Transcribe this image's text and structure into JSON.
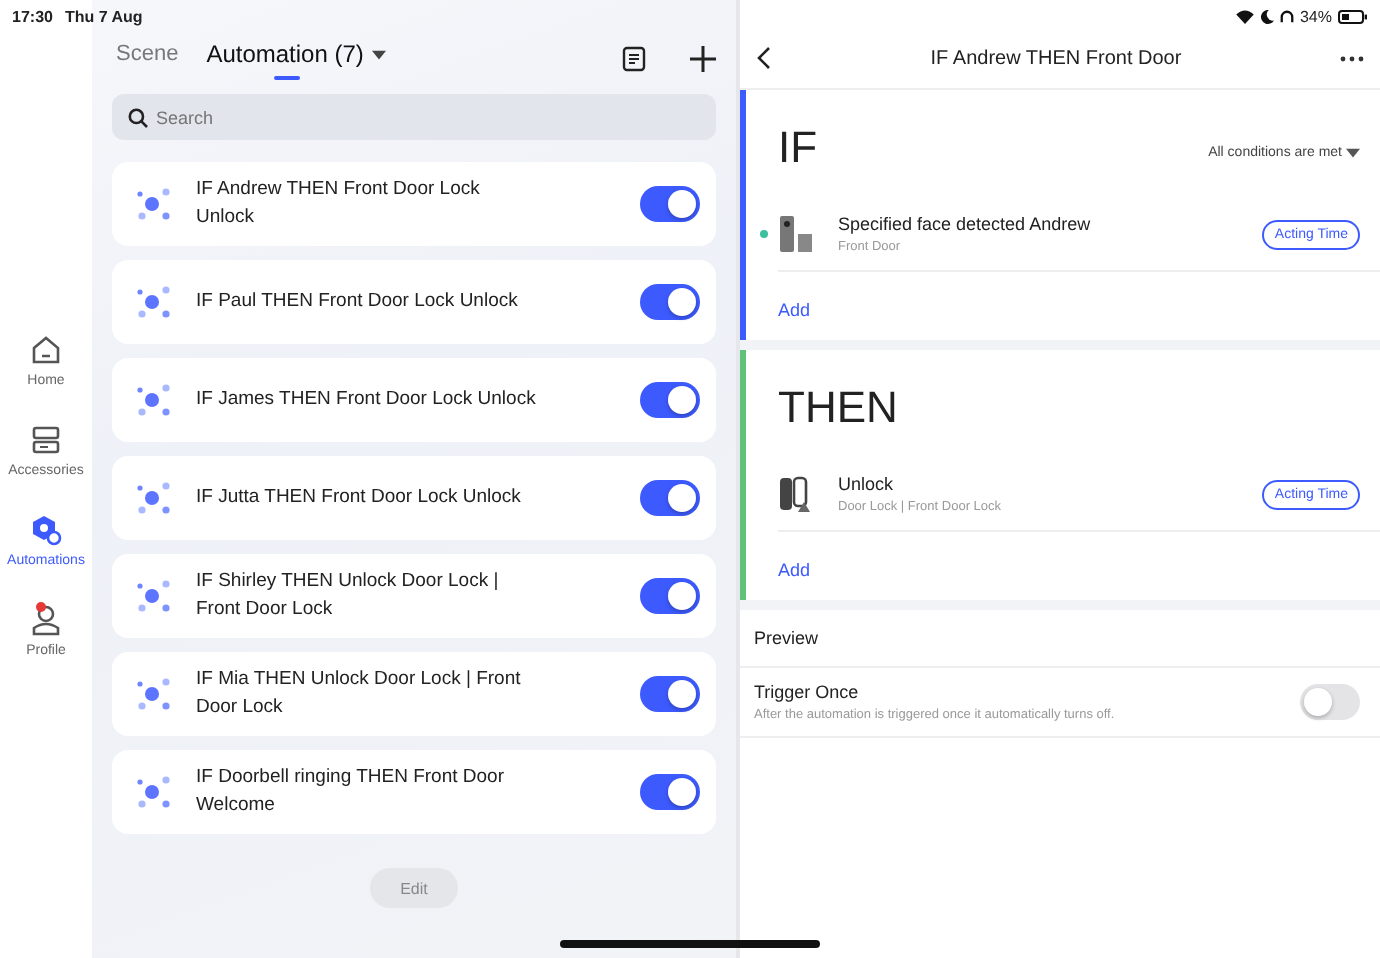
{
  "status_bar": {
    "time": "17:30",
    "date": "Thu 7 Aug",
    "battery": "34%"
  },
  "nav": [
    {
      "label": "Home",
      "kind": "home",
      "selected": false,
      "badge": false
    },
    {
      "label": "Accessories",
      "kind": "accessories",
      "selected": false,
      "badge": false
    },
    {
      "label": "Automations",
      "kind": "automations",
      "selected": true,
      "badge": false
    },
    {
      "label": "Profile",
      "kind": "profile",
      "selected": false,
      "badge": true
    }
  ],
  "tabs": [
    {
      "label": "Scene",
      "selected": false
    },
    {
      "label": "Automation (7)",
      "selected": true
    }
  ],
  "search": {
    "placeholder": "Search"
  },
  "automations": [
    {
      "name": "IF Andrew THEN Front Door Lock Unlock",
      "on": true
    },
    {
      "name": "IF Paul THEN Front Door Lock Unlock",
      "on": true
    },
    {
      "name": "IF James THEN Front Door Lock Unlock",
      "on": true
    },
    {
      "name": "IF Jutta THEN Front Door Lock Unlock",
      "on": true
    },
    {
      "name": "IF Shirley THEN Unlock Door Lock | Front Door Lock",
      "on": true
    },
    {
      "name": "IF Mia THEN Unlock Door Lock | Front Door Lock",
      "on": true
    },
    {
      "name": "IF Doorbell ringing  THEN Front Door Welcome",
      "on": true
    }
  ],
  "edit_button": "Edit",
  "detail": {
    "title": "IF Andrew THEN Front Door",
    "if_section": {
      "heading": "IF",
      "condition_mode": "All conditions are met",
      "items": [
        {
          "title": "Specified face detected Andrew",
          "subtitle": "Front Door",
          "kind": "doorbell",
          "online": true,
          "action": "Acting Time"
        }
      ],
      "add": "Add"
    },
    "then_section": {
      "heading": "THEN",
      "items": [
        {
          "title": "Unlock",
          "subtitle": "Door Lock | Front Door Lock",
          "kind": "lock",
          "online": false,
          "action": "Acting Time"
        }
      ],
      "add": "Add"
    },
    "preview": "Preview",
    "trigger_once": {
      "label": "Trigger Once",
      "description": "After the automation is triggered once it automatically turns off.",
      "on": false
    }
  }
}
